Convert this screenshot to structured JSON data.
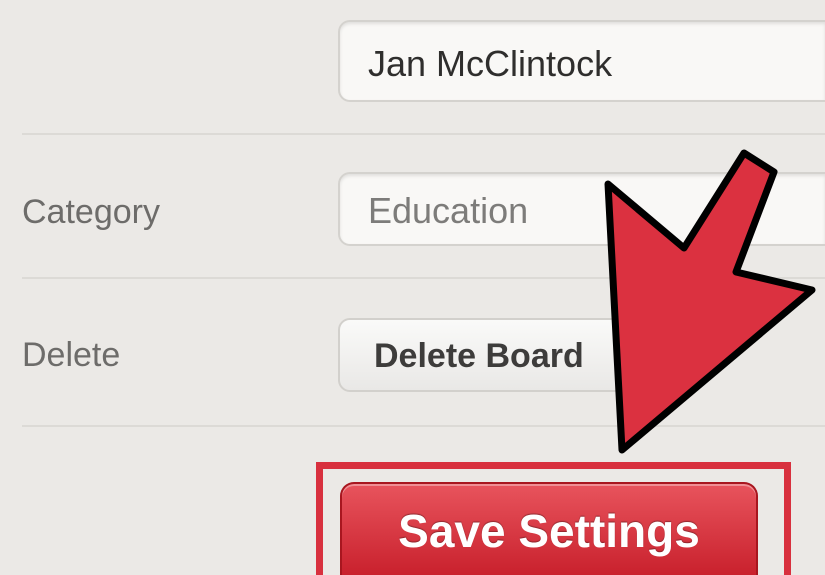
{
  "owner": {
    "value": "Jan McClintock"
  },
  "category": {
    "label": "Category",
    "value": "Education"
  },
  "delete": {
    "label": "Delete",
    "button_label": "Delete Board"
  },
  "save": {
    "button_label": "Save Settings"
  },
  "colors": {
    "accent": "#d8303e",
    "save_button": "#d22f3a",
    "background": "#ebe9e6"
  },
  "icons": {
    "pointer": "arrow-pointer-icon"
  }
}
